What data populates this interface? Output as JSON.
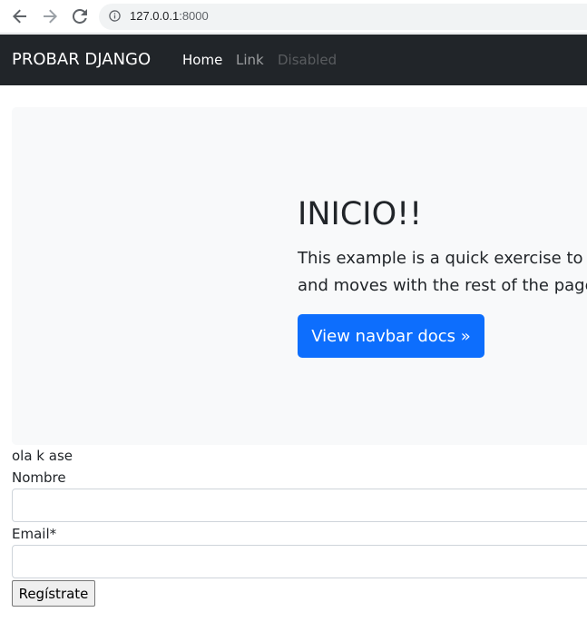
{
  "browser": {
    "url_host": "127.0.0.1",
    "url_port": ":8000",
    "icons": [
      "back-arrow-icon",
      "forward-arrow-icon",
      "reload-icon",
      "info-icon"
    ]
  },
  "navbar": {
    "brand": "PROBAR DJANGO",
    "links": [
      {
        "label": "Home",
        "state": "active"
      },
      {
        "label": "Link",
        "state": "normal"
      },
      {
        "label": "Disabled",
        "state": "disabled"
      }
    ],
    "background": "#212529"
  },
  "jumbotron": {
    "title": "INICIO!!",
    "lead_line1": "This example is a quick exercise to ill",
    "lead_line2": "and moves with the rest of the page",
    "button_label": "View navbar docs »",
    "button_color": "#0d6efd"
  },
  "form": {
    "intro_text": "ola k ase",
    "nombre_label": "Nombre",
    "nombre_value": "",
    "email_label": "Email*",
    "email_value": "",
    "submit_label": "Regístrate"
  }
}
